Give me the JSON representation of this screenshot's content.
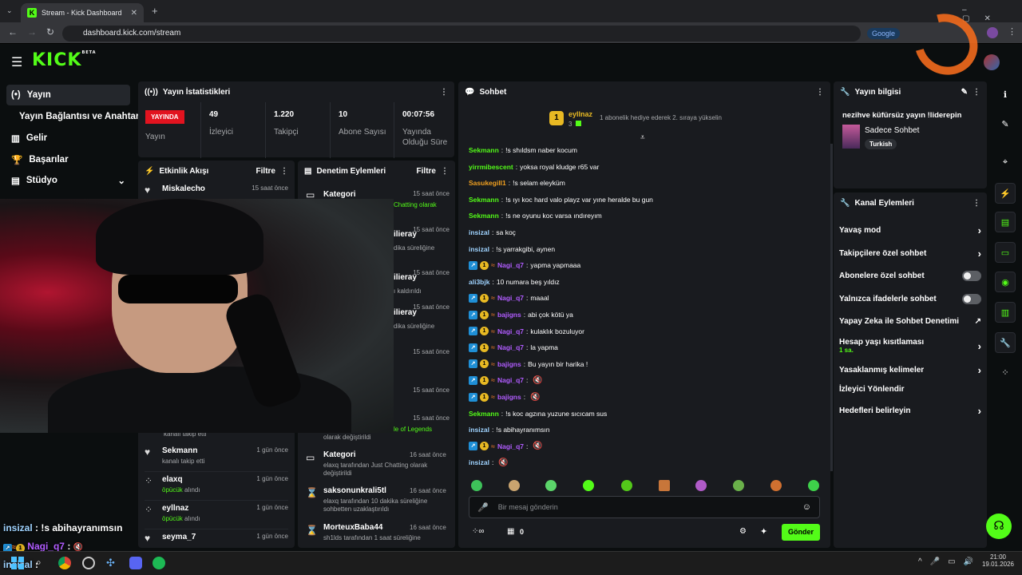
{
  "browser": {
    "tab_title": "Stream - Kick Dashboard",
    "url": "dashboard.kick.com/stream",
    "google_chip": "Google"
  },
  "sidebar": {
    "items": [
      {
        "label": "Yayın",
        "icon": "broadcast-icon"
      },
      {
        "label": "Yayın Bağlantısı ve Anahtarı"
      },
      {
        "label": "Gelir",
        "icon": "chart-icon"
      },
      {
        "label": "Başarılar",
        "icon": "trophy-icon"
      },
      {
        "label": "Stüdyo",
        "icon": "studio-icon"
      }
    ]
  },
  "stats": {
    "title": "Yayın İstatistikleri",
    "live": "YAYINDA",
    "live_label": "Yayın",
    "viewers": "49",
    "viewers_label": "İzleyici",
    "followers": "1.220",
    "followers_label": "Takipçi",
    "subs": "10",
    "subs_label": "Abone Sayısı",
    "uptime": "00:07:56",
    "uptime_label": "Yayında Olduğu Süre"
  },
  "activity": {
    "title": "Etkinlik Akışı",
    "filter": "Filtre",
    "items": [
      {
        "name": "Miskalecho",
        "sub": "",
        "time": "15 saat önce"
      },
      {
        "name": "",
        "sub": "kanalı takip etti",
        "time": ""
      },
      {
        "name": "Sekmann",
        "sub": "kanalı takip etti",
        "time": "1 gün önce"
      },
      {
        "name": "elaxq",
        "sub": "öpücük",
        "sub2": "alındı",
        "time": "1 gün önce"
      },
      {
        "name": "eyllnaz",
        "sub": "öpücük",
        "sub2": "alındı",
        "time": "1 gün önce"
      },
      {
        "name": "seyma_7",
        "sub": "",
        "time": "1 gün önce"
      }
    ]
  },
  "moderation": {
    "title": "Denetim Eylemleri",
    "filter": "Filtre",
    "items": [
      {
        "name": "Kategori",
        "sub": "Chatting olarak",
        "time": "15 saat önce"
      },
      {
        "name": "ilieray",
        "sub": "dika süreliğine",
        "time": "15 saat önce"
      },
      {
        "name": "ilieray",
        "sub": "ı kaldırıldı",
        "time": "15 saat önce"
      },
      {
        "name": "ilieray",
        "sub": "dika süreliğine",
        "time": "15 saat önce"
      },
      {
        "name": "",
        "sub": "",
        "time": "15 saat önce"
      },
      {
        "name": "",
        "sub": "",
        "time": "15 saat önce"
      },
      {
        "name": "",
        "sub": "le of Legends",
        "sub2": "olarak değiştirildi",
        "time": "15 saat önce"
      },
      {
        "name": "Kategori",
        "sub": "elaxq tarafından Just Chatting olarak değiştirildi",
        "time": "16 saat önce"
      },
      {
        "name": "saksonunkrali5tl",
        "sub": "elaxq tarafından 10 dakika süreliğine sohbetten uzaklaştırıldı",
        "time": "16 saat önce"
      },
      {
        "name": "MorteuxBaba44",
        "sub": "sh1lds tarafından 1 saat süreliğine",
        "time": "16 saat önce"
      }
    ]
  },
  "chat": {
    "title": "Sohbet",
    "gifter": "eyllnaz",
    "gifter_count": "3",
    "gift_msg": "1 abonelik hediye ederek 2. sıraya yükselin",
    "placeholder": "Bir mesaj gönderin",
    "points": "0",
    "send": "Gönder",
    "messages": [
      {
        "user": "Sekmann",
        "color": "#53fc18",
        "text": "!s shıldsm naber kocum",
        "badges": false
      },
      {
        "user": "yirrmibescent",
        "color": "#53fc18",
        "text": "yoksa royal kludge r65 var",
        "badges": false
      },
      {
        "user": "Sasukegill1",
        "color": "#f0a020",
        "text": "!s selam eleyküm",
        "badges": false
      },
      {
        "user": "Sekmann",
        "color": "#53fc18",
        "text": "!s ıyı koc hard valo playz var yıne heralde bu gun",
        "badges": false
      },
      {
        "user": "Sekmann",
        "color": "#53fc18",
        "text": "!s ne oyunu koc varsa ındıreyım",
        "badges": false
      },
      {
        "user": "insizal",
        "color": "#9fd3ff",
        "text": "sa koç",
        "badges": false
      },
      {
        "user": "insizal",
        "color": "#9fd3ff",
        "text": "!s yarrakgibi, aynen",
        "badges": false
      },
      {
        "user": "Nagi_q7",
        "color": "#b15cff",
        "text": "yapma yapmaaa",
        "badges": true
      },
      {
        "user": "ali3bjk",
        "color": "#9fd3ff",
        "text": "10 numara beş yıldız",
        "badges": false
      },
      {
        "user": "Nagi_q7",
        "color": "#b15cff",
        "text": "maaal",
        "badges": true
      },
      {
        "user": "bajigns",
        "color": "#b15cff",
        "text": "abi çok kötü ya",
        "badges": true
      },
      {
        "user": "Nagi_q7",
        "color": "#b15cff",
        "text": "kulaklık bozuluyor",
        "badges": true
      },
      {
        "user": "Nagi_q7",
        "color": "#b15cff",
        "text": "la yapma",
        "badges": true
      },
      {
        "user": "bajigns",
        "color": "#b15cff",
        "text": "Bu yayın bir harika !",
        "badges": true
      },
      {
        "user": "Nagi_q7",
        "color": "#b15cff",
        "text": "",
        "badges": true,
        "mute": true
      },
      {
        "user": "bajigns",
        "color": "#b15cff",
        "text": "",
        "badges": true,
        "mute": true
      },
      {
        "user": "Sekmann",
        "color": "#53fc18",
        "text": "!s koc agzına yuzune sıcıcam sus",
        "badges": false
      },
      {
        "user": "insizal",
        "color": "#9fd3ff",
        "text": "!s abihayranımsın",
        "badges": false
      },
      {
        "user": "Nagi_q7",
        "color": "#b15cff",
        "text": "",
        "badges": true,
        "mute": true
      },
      {
        "user": "insizal",
        "color": "#9fd3ff",
        "text": "",
        "badges": false,
        "mute": true
      }
    ]
  },
  "info": {
    "title": "Yayın bilgisi",
    "stream_title": "nezihve küfürsüz yayın !liderepin",
    "category": "Sadece Sohbet",
    "language": "Turkish"
  },
  "channel": {
    "title": "Kanal Eylemleri",
    "items": [
      {
        "label": "Yavaş mod",
        "type": "chev"
      },
      {
        "label": "Takipçilere özel sohbet",
        "type": "chev"
      },
      {
        "label": "Abonelere özel sohbet",
        "type": "toggle"
      },
      {
        "label": "Yalnızca ifadelerle sohbet",
        "type": "toggle"
      },
      {
        "label": "Yapay Zeka ile Sohbet Denetimi",
        "type": "ext"
      },
      {
        "label": "Hesap yaşı kısıtlaması",
        "sub": "1 sa.",
        "type": "chev"
      },
      {
        "label": "Yasaklanmış kelimeler",
        "type": "chev"
      },
      {
        "label": "İzleyici Yönlendir",
        "type": "none"
      },
      {
        "label": "Hedefleri belirleyin",
        "type": "chev"
      }
    ]
  },
  "overlay": {
    "line1_user": "insizal",
    "line1_text": ": !s abihayranımsın",
    "line2_user": "Nagi_q7",
    "line2_text": ":",
    "line3_user": "insizal",
    "line3_text": ":"
  },
  "taskbar": {
    "time": "21:00",
    "date": "19.01.2026"
  },
  "colors": {
    "accent": "#53fc18",
    "live": "#e2131f",
    "panel": "#191b1f"
  }
}
